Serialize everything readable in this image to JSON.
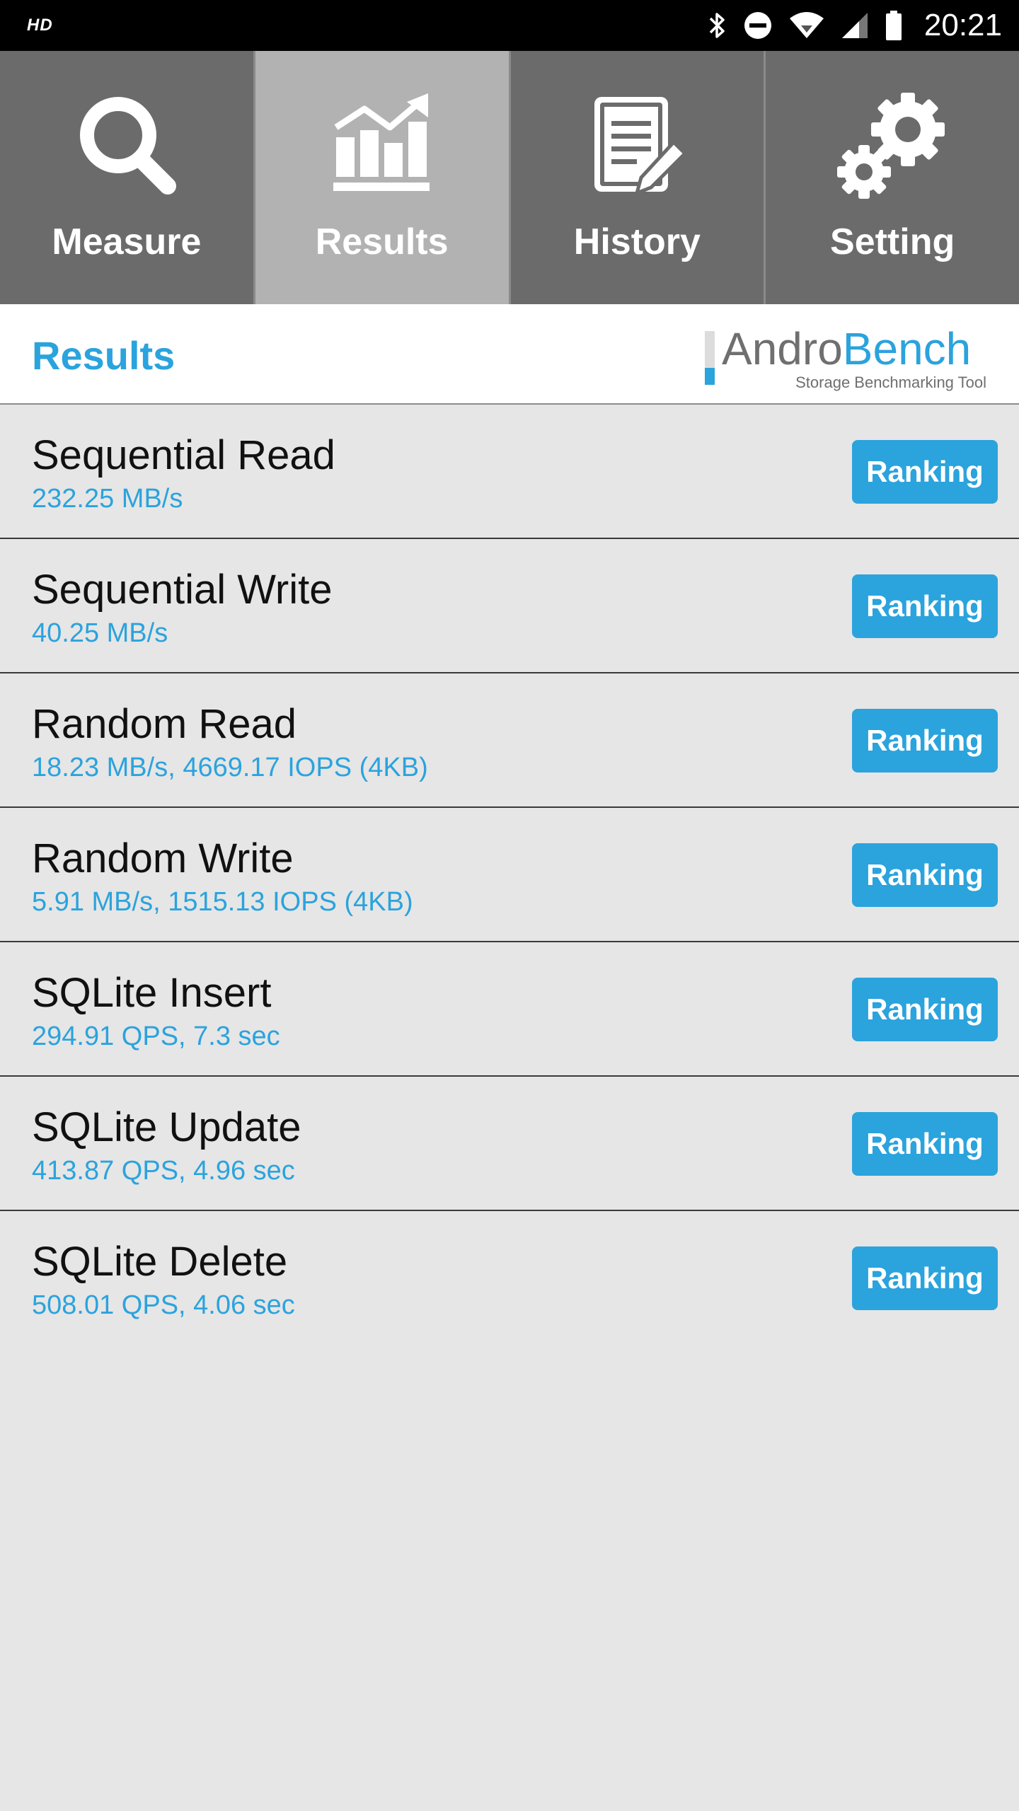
{
  "status_bar": {
    "hd_label": "HD",
    "time": "20:21",
    "icons": [
      "bluetooth-icon",
      "do-not-disturb-icon",
      "wifi-icon",
      "cell-signal-icon",
      "battery-icon"
    ]
  },
  "tabs": [
    {
      "label": "Measure",
      "icon": "magnifier-icon",
      "active": false
    },
    {
      "label": "Results",
      "icon": "chart-trend-icon",
      "active": true
    },
    {
      "label": "History",
      "icon": "document-pen-icon",
      "active": false
    },
    {
      "label": "Setting",
      "icon": "gears-icon",
      "active": false
    }
  ],
  "header": {
    "title": "Results",
    "logo_andro": "Andro",
    "logo_bench": "Bench",
    "logo_sub": "Storage Benchmarking Tool"
  },
  "results": [
    {
      "name": "Sequential Read",
      "value": "232.25 MB/s",
      "button": "Ranking"
    },
    {
      "name": "Sequential Write",
      "value": "40.25 MB/s",
      "button": "Ranking"
    },
    {
      "name": "Random Read",
      "value": "18.23 MB/s, 4669.17 IOPS (4KB)",
      "button": "Ranking"
    },
    {
      "name": "Random Write",
      "value": "5.91 MB/s, 1515.13 IOPS (4KB)",
      "button": "Ranking"
    },
    {
      "name": "SQLite Insert",
      "value": "294.91 QPS, 7.3 sec",
      "button": "Ranking"
    },
    {
      "name": "SQLite Update",
      "value": "413.87 QPS, 4.96 sec",
      "button": "Ranking"
    },
    {
      "name": "SQLite Delete",
      "value": "508.01 QPS, 4.06 sec",
      "button": "Ranking"
    }
  ],
  "colors": {
    "accent": "#2ba3dd",
    "tab_bg": "#6b6b6b",
    "tab_active_bg": "#b2b2b2",
    "list_bg": "#e6e6e6"
  }
}
